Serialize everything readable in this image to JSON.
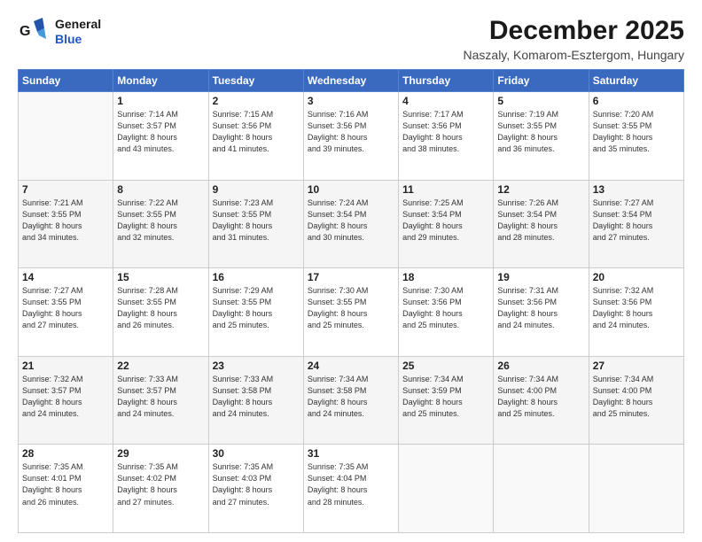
{
  "logo": {
    "line1": "General",
    "line2": "Blue"
  },
  "title": "December 2025",
  "subtitle": "Naszaly, Komarom-Esztergom, Hungary",
  "days_header": [
    "Sunday",
    "Monday",
    "Tuesday",
    "Wednesday",
    "Thursday",
    "Friday",
    "Saturday"
  ],
  "weeks": [
    [
      {
        "num": "",
        "info": ""
      },
      {
        "num": "1",
        "info": "Sunrise: 7:14 AM\nSunset: 3:57 PM\nDaylight: 8 hours\nand 43 minutes."
      },
      {
        "num": "2",
        "info": "Sunrise: 7:15 AM\nSunset: 3:56 PM\nDaylight: 8 hours\nand 41 minutes."
      },
      {
        "num": "3",
        "info": "Sunrise: 7:16 AM\nSunset: 3:56 PM\nDaylight: 8 hours\nand 39 minutes."
      },
      {
        "num": "4",
        "info": "Sunrise: 7:17 AM\nSunset: 3:56 PM\nDaylight: 8 hours\nand 38 minutes."
      },
      {
        "num": "5",
        "info": "Sunrise: 7:19 AM\nSunset: 3:55 PM\nDaylight: 8 hours\nand 36 minutes."
      },
      {
        "num": "6",
        "info": "Sunrise: 7:20 AM\nSunset: 3:55 PM\nDaylight: 8 hours\nand 35 minutes."
      }
    ],
    [
      {
        "num": "7",
        "info": "Sunrise: 7:21 AM\nSunset: 3:55 PM\nDaylight: 8 hours\nand 34 minutes."
      },
      {
        "num": "8",
        "info": "Sunrise: 7:22 AM\nSunset: 3:55 PM\nDaylight: 8 hours\nand 32 minutes."
      },
      {
        "num": "9",
        "info": "Sunrise: 7:23 AM\nSunset: 3:55 PM\nDaylight: 8 hours\nand 31 minutes."
      },
      {
        "num": "10",
        "info": "Sunrise: 7:24 AM\nSunset: 3:54 PM\nDaylight: 8 hours\nand 30 minutes."
      },
      {
        "num": "11",
        "info": "Sunrise: 7:25 AM\nSunset: 3:54 PM\nDaylight: 8 hours\nand 29 minutes."
      },
      {
        "num": "12",
        "info": "Sunrise: 7:26 AM\nSunset: 3:54 PM\nDaylight: 8 hours\nand 28 minutes."
      },
      {
        "num": "13",
        "info": "Sunrise: 7:27 AM\nSunset: 3:54 PM\nDaylight: 8 hours\nand 27 minutes."
      }
    ],
    [
      {
        "num": "14",
        "info": "Sunrise: 7:27 AM\nSunset: 3:55 PM\nDaylight: 8 hours\nand 27 minutes."
      },
      {
        "num": "15",
        "info": "Sunrise: 7:28 AM\nSunset: 3:55 PM\nDaylight: 8 hours\nand 26 minutes."
      },
      {
        "num": "16",
        "info": "Sunrise: 7:29 AM\nSunset: 3:55 PM\nDaylight: 8 hours\nand 25 minutes."
      },
      {
        "num": "17",
        "info": "Sunrise: 7:30 AM\nSunset: 3:55 PM\nDaylight: 8 hours\nand 25 minutes."
      },
      {
        "num": "18",
        "info": "Sunrise: 7:30 AM\nSunset: 3:56 PM\nDaylight: 8 hours\nand 25 minutes."
      },
      {
        "num": "19",
        "info": "Sunrise: 7:31 AM\nSunset: 3:56 PM\nDaylight: 8 hours\nand 24 minutes."
      },
      {
        "num": "20",
        "info": "Sunrise: 7:32 AM\nSunset: 3:56 PM\nDaylight: 8 hours\nand 24 minutes."
      }
    ],
    [
      {
        "num": "21",
        "info": "Sunrise: 7:32 AM\nSunset: 3:57 PM\nDaylight: 8 hours\nand 24 minutes."
      },
      {
        "num": "22",
        "info": "Sunrise: 7:33 AM\nSunset: 3:57 PM\nDaylight: 8 hours\nand 24 minutes."
      },
      {
        "num": "23",
        "info": "Sunrise: 7:33 AM\nSunset: 3:58 PM\nDaylight: 8 hours\nand 24 minutes."
      },
      {
        "num": "24",
        "info": "Sunrise: 7:34 AM\nSunset: 3:58 PM\nDaylight: 8 hours\nand 24 minutes."
      },
      {
        "num": "25",
        "info": "Sunrise: 7:34 AM\nSunset: 3:59 PM\nDaylight: 8 hours\nand 25 minutes."
      },
      {
        "num": "26",
        "info": "Sunrise: 7:34 AM\nSunset: 4:00 PM\nDaylight: 8 hours\nand 25 minutes."
      },
      {
        "num": "27",
        "info": "Sunrise: 7:34 AM\nSunset: 4:00 PM\nDaylight: 8 hours\nand 25 minutes."
      }
    ],
    [
      {
        "num": "28",
        "info": "Sunrise: 7:35 AM\nSunset: 4:01 PM\nDaylight: 8 hours\nand 26 minutes."
      },
      {
        "num": "29",
        "info": "Sunrise: 7:35 AM\nSunset: 4:02 PM\nDaylight: 8 hours\nand 27 minutes."
      },
      {
        "num": "30",
        "info": "Sunrise: 7:35 AM\nSunset: 4:03 PM\nDaylight: 8 hours\nand 27 minutes."
      },
      {
        "num": "31",
        "info": "Sunrise: 7:35 AM\nSunset: 4:04 PM\nDaylight: 8 hours\nand 28 minutes."
      },
      {
        "num": "",
        "info": ""
      },
      {
        "num": "",
        "info": ""
      },
      {
        "num": "",
        "info": ""
      }
    ]
  ]
}
